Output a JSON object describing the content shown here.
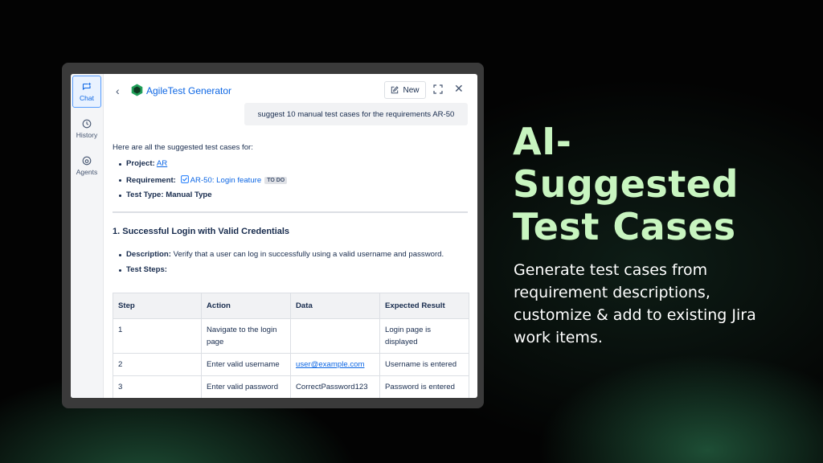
{
  "app": {
    "title": "AgileTest Generator",
    "new_label": "New"
  },
  "rail": {
    "chat": "Chat",
    "history": "History",
    "agents": "Agents"
  },
  "user_message": "suggest 10 manual test cases for the requirements AR-50",
  "response": {
    "intro": "Here are all the suggested test cases for:",
    "project_label": "Project:",
    "project_value": "AR",
    "requirement_label": "Requirement:",
    "requirement_value": "AR-50: Login feature",
    "requirement_status": "TO DO",
    "test_type_label": "Test Type:",
    "test_type_value": "Manual Type",
    "case_title": "1. Successful Login with Valid Credentials",
    "description_label": "Description:",
    "description_value": "Verify that a user can log in successfully using a valid username and password.",
    "steps_label": "Test Steps:",
    "table": {
      "headers": [
        "Step",
        "Action",
        "Data",
        "Expected Result"
      ],
      "rows": [
        [
          "1",
          "Navigate to the login page",
          "",
          "Login page is displayed"
        ],
        [
          "2",
          "Enter valid username",
          "user@example.com",
          "Username is entered"
        ],
        [
          "3",
          "Enter valid password",
          "CorrectPassword123",
          "Password is entered"
        ]
      ]
    }
  },
  "promo": {
    "headline_line1": "AI-",
    "headline_line2": "Suggested",
    "headline_line3": "Test Cases",
    "body_line1": "Generate test cases from",
    "body_line2": "requirement descriptions,",
    "body_line3": "customize & add to existing Jira",
    "body_line4": "work items.",
    "headline_color": "#c8f5c0"
  }
}
